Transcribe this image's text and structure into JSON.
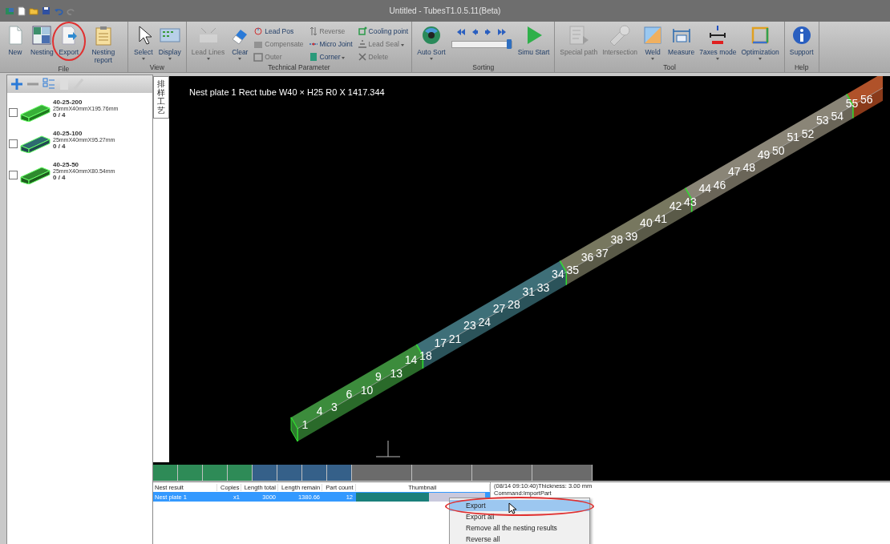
{
  "window": {
    "title": "Untitled - TubesT1.0.5.11(Beta)"
  },
  "ribbon": {
    "groups": [
      {
        "label": "File",
        "items": [
          {
            "kind": "large",
            "label": "New",
            "disabled": false,
            "dropdown": false,
            "highlighted": false
          },
          {
            "kind": "large",
            "label": "Nesting",
            "disabled": false,
            "dropdown": false,
            "highlighted": false
          },
          {
            "kind": "large",
            "label": "Export",
            "disabled": false,
            "dropdown": false,
            "highlighted": true
          },
          {
            "kind": "large",
            "label": "Nesting report",
            "disabled": false,
            "dropdown": false,
            "highlighted": false
          }
        ]
      },
      {
        "label": "View",
        "items": [
          {
            "kind": "large",
            "label": "Select",
            "disabled": false,
            "dropdown": true,
            "highlighted": false
          },
          {
            "kind": "large",
            "label": "Display",
            "disabled": false,
            "dropdown": true,
            "highlighted": false
          }
        ]
      },
      {
        "label": "Technical Parameter",
        "items": [
          {
            "kind": "large",
            "label": "Lead Lines",
            "disabled": true,
            "dropdown": true,
            "highlighted": false
          },
          {
            "kind": "large",
            "label": "Clear",
            "disabled": false,
            "dropdown": true,
            "highlighted": false
          },
          {
            "kind": "small",
            "label": "Lead Pos",
            "disabled": false,
            "dropdown": false
          },
          {
            "kind": "small",
            "label": "Compensate",
            "disabled": true,
            "dropdown": false
          },
          {
            "kind": "small",
            "label": "Outer",
            "disabled": true,
            "dropdown": false
          },
          {
            "kind": "small",
            "label": "Reverse",
            "disabled": true,
            "dropdown": false
          },
          {
            "kind": "small",
            "label": "Micro Joint",
            "disabled": false,
            "dropdown": false
          },
          {
            "kind": "small",
            "label": "Corner",
            "disabled": false,
            "dropdown": true
          },
          {
            "kind": "small",
            "label": "Cooling point",
            "disabled": false,
            "dropdown": false
          },
          {
            "kind": "small",
            "label": "Lead Seal",
            "disabled": true,
            "dropdown": true
          },
          {
            "kind": "small",
            "label": "Delete",
            "disabled": true,
            "dropdown": false
          }
        ]
      },
      {
        "label": "Sorting",
        "items": [
          {
            "kind": "large",
            "label": "Auto Sort",
            "disabled": false,
            "dropdown": true,
            "highlighted": false
          },
          {
            "kind": "nav",
            "level": 0.97
          },
          {
            "kind": "large",
            "label": "Simu Start",
            "disabled": false,
            "dropdown": false,
            "highlighted": false
          }
        ]
      },
      {
        "label": "Tool",
        "items": [
          {
            "kind": "large",
            "label": "Special path",
            "disabled": true,
            "dropdown": false,
            "highlighted": false
          },
          {
            "kind": "large",
            "label": "Intersection",
            "disabled": true,
            "dropdown": false,
            "highlighted": false
          },
          {
            "kind": "large",
            "label": "Weld",
            "disabled": false,
            "dropdown": true,
            "highlighted": false
          },
          {
            "kind": "large",
            "label": "Measure",
            "disabled": false,
            "dropdown": false,
            "highlighted": false
          },
          {
            "kind": "large",
            "label": "7axes mode",
            "disabled": false,
            "dropdown": true,
            "highlighted": false
          },
          {
            "kind": "large",
            "label": "Optimization",
            "disabled": false,
            "dropdown": true,
            "highlighted": false
          }
        ]
      },
      {
        "label": "Help",
        "items": [
          {
            "kind": "large",
            "label": "Support",
            "disabled": false,
            "dropdown": false,
            "highlighted": false
          }
        ]
      }
    ]
  },
  "parts": [
    {
      "name": "40-25-200",
      "size": "25mmX40mmX195.76mm",
      "count": "0 / 4",
      "checked": false
    },
    {
      "name": "40-25-100",
      "size": "25mmX40mmX95.27mm",
      "count": "0 / 4",
      "checked": false
    },
    {
      "name": "40-25-50",
      "size": "25mmX40mmX80.54mm",
      "count": "0 / 4",
      "checked": false
    }
  ],
  "side_tab": {
    "label": "排样工艺"
  },
  "canvas": {
    "caption": "Nest plate 1 Rect tube W40 × H25 R0 X 1417.344",
    "part_labels": [
      "1",
      "4",
      "3",
      "6",
      "10",
      "9",
      "13",
      "14",
      "18",
      "17",
      "21",
      "23",
      "24",
      "27",
      "28",
      "31",
      "33",
      "34",
      "35",
      "36",
      "37",
      "38",
      "39",
      "40",
      "41",
      "42",
      "43",
      "44",
      "46",
      "47",
      "48",
      "49",
      "50",
      "51",
      "52",
      "53",
      "54",
      "55",
      "56"
    ]
  },
  "nest_strip": [
    {
      "kind": "part",
      "color": "#2e8b57"
    },
    {
      "kind": "part",
      "color": "#2e8b57"
    },
    {
      "kind": "part",
      "color": "#2e8b57"
    },
    {
      "kind": "part",
      "color": "#2e8b57"
    },
    {
      "kind": "part",
      "color": "#356089"
    },
    {
      "kind": "part",
      "color": "#356089"
    },
    {
      "kind": "part",
      "color": "#356089"
    },
    {
      "kind": "part",
      "color": "#356089"
    },
    {
      "kind": "scrap",
      "color": "#6b6b6b"
    },
    {
      "kind": "scrap",
      "color": "#6b6b6b"
    },
    {
      "kind": "scrap",
      "color": "#6b6b6b"
    },
    {
      "kind": "scrap",
      "color": "#6b6b6b"
    }
  ],
  "table": {
    "columns": [
      "Nest result",
      "Copies",
      "Length total",
      "Length remain",
      "Part count",
      "Thumbnail"
    ],
    "rows": [
      {
        "cells": [
          "Nest plate 1",
          "x1",
          "3000",
          "1380.66",
          "12"
        ],
        "level": 0.54,
        "selected": true
      }
    ]
  },
  "log": [
    "(08/14 09:10:40)Thickness: 3.00 mm",
    "Command:ImportPart"
  ],
  "context_menu": [
    {
      "label": "Export",
      "selected": true,
      "highlighted": true
    },
    {
      "label": "Export all",
      "selected": false,
      "highlighted": false
    },
    {
      "label": "Remove all the nesting results",
      "selected": false,
      "highlighted": false
    },
    {
      "label": "Reverse all",
      "selected": false,
      "highlighted": false
    }
  ]
}
